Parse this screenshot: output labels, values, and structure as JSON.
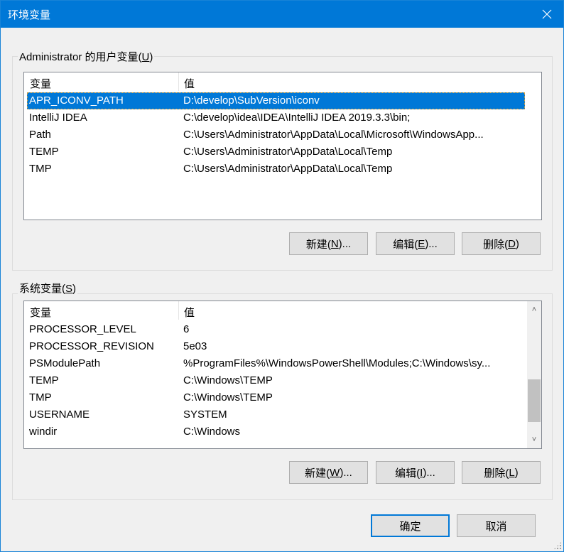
{
  "window": {
    "title": "环境变量",
    "close_icon": "close-icon"
  },
  "user_group": {
    "label_prefix": "Administrator 的用户变量(",
    "label_key": "U",
    "label_suffix": ")",
    "headers": [
      "变量",
      "值"
    ],
    "rows": [
      {
        "name": "APR_ICONV_PATH",
        "value": "D:\\develop\\SubVersion\\iconv",
        "selected": true
      },
      {
        "name": "IntelliJ IDEA",
        "value": "C:\\develop\\idea\\IDEA\\IntelliJ IDEA 2019.3.3\\bin;"
      },
      {
        "name": "Path",
        "value": "C:\\Users\\Administrator\\AppData\\Local\\Microsoft\\WindowsApp..."
      },
      {
        "name": "TEMP",
        "value": "C:\\Users\\Administrator\\AppData\\Local\\Temp"
      },
      {
        "name": "TMP",
        "value": "C:\\Users\\Administrator\\AppData\\Local\\Temp"
      }
    ],
    "buttons": [
      {
        "pre": "新建(",
        "key": "N",
        "post": ")..."
      },
      {
        "pre": "编辑(",
        "key": "E",
        "post": ")..."
      },
      {
        "pre": "删除(",
        "key": "D",
        "post": ")"
      }
    ]
  },
  "system_group": {
    "label_prefix": "系统变量(",
    "label_key": "S",
    "label_suffix": ")",
    "headers": [
      "变量",
      "值"
    ],
    "rows": [
      {
        "name": "PROCESSOR_LEVEL",
        "value": "6"
      },
      {
        "name": "PROCESSOR_REVISION",
        "value": "5e03"
      },
      {
        "name": "PSModulePath",
        "value": "%ProgramFiles%\\WindowsPowerShell\\Modules;C:\\Windows\\sy..."
      },
      {
        "name": "TEMP",
        "value": "C:\\Windows\\TEMP"
      },
      {
        "name": "TMP",
        "value": "C:\\Windows\\TEMP"
      },
      {
        "name": "USERNAME",
        "value": "SYSTEM"
      },
      {
        "name": "windir",
        "value": "C:\\Windows"
      }
    ],
    "scroll_position": 0.85,
    "buttons": [
      {
        "pre": "新建(",
        "key": "W",
        "post": ")..."
      },
      {
        "pre": "编辑(",
        "key": "I",
        "post": ")..."
      },
      {
        "pre": "删除(",
        "key": "L",
        "post": ")"
      }
    ]
  },
  "footer": {
    "ok": "确定",
    "cancel": "取消"
  }
}
